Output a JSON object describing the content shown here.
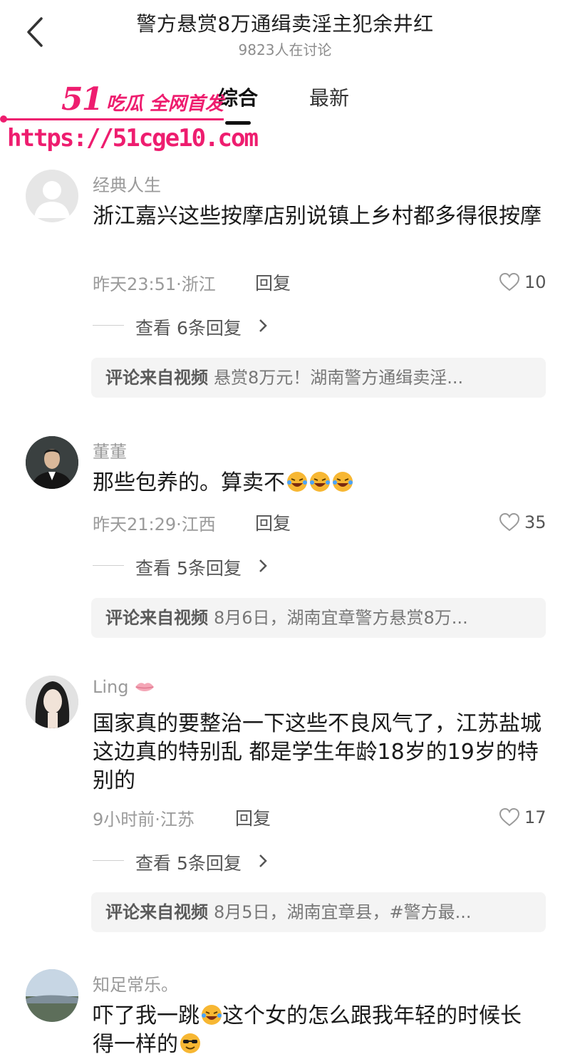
{
  "header": {
    "title": "警方悬赏8万通缉卖淫主犯余井红",
    "subtitle": "9823人在讨论",
    "tabs": [
      {
        "label": "综合",
        "active": true
      },
      {
        "label": "最新",
        "active": false
      }
    ]
  },
  "watermark": {
    "num": "51",
    "text": "吃瓜 全网首发",
    "url": "https://51cge10.com",
    "color": "#ee1d6f"
  },
  "comments": [
    {
      "user": "经典人生",
      "text": "浙江嘉兴这些按摩店别说镇上乡村都多得很按摩",
      "meta": "昨天23:51·浙江",
      "reply_label": "回复",
      "likes": "10",
      "view_replies": "查看 6条回复",
      "source_label": "评论来自视频",
      "source_text": "悬赏8万元！湖南警方通缉卖淫..."
    },
    {
      "user": "董董",
      "text": "那些包养的。算卖不",
      "emoji": [
        "laughing-crying-emoji",
        "laughing-crying-emoji",
        "laughing-crying-emoji"
      ],
      "meta": "昨天21:29·江西",
      "reply_label": "回复",
      "likes": "35",
      "view_replies": "查看 5条回复",
      "source_label": "评论来自视频",
      "source_text": "8月6日，湖南宜章警方悬赏8万..."
    },
    {
      "user": "Ling",
      "user_icon": "lips-icon",
      "text": "国家真的要整治一下这些不良风气了，江苏盐城这边真的特别乱 都是学生年龄18岁的19岁的特别的",
      "meta": "9小时前·江苏",
      "reply_label": "回复",
      "likes": "17",
      "view_replies": "查看 5条回复",
      "source_label": "评论来自视频",
      "source_text": "8月5日，湖南宜章县，#警方最..."
    },
    {
      "user": "知足常乐。",
      "text_1": "吓了我一跳",
      "text_2": "这个女的怎么跟我年轻的时候长得一样的",
      "emoji": [
        "laughing-crying-emoji",
        "sunglasses-emoji"
      ]
    }
  ]
}
